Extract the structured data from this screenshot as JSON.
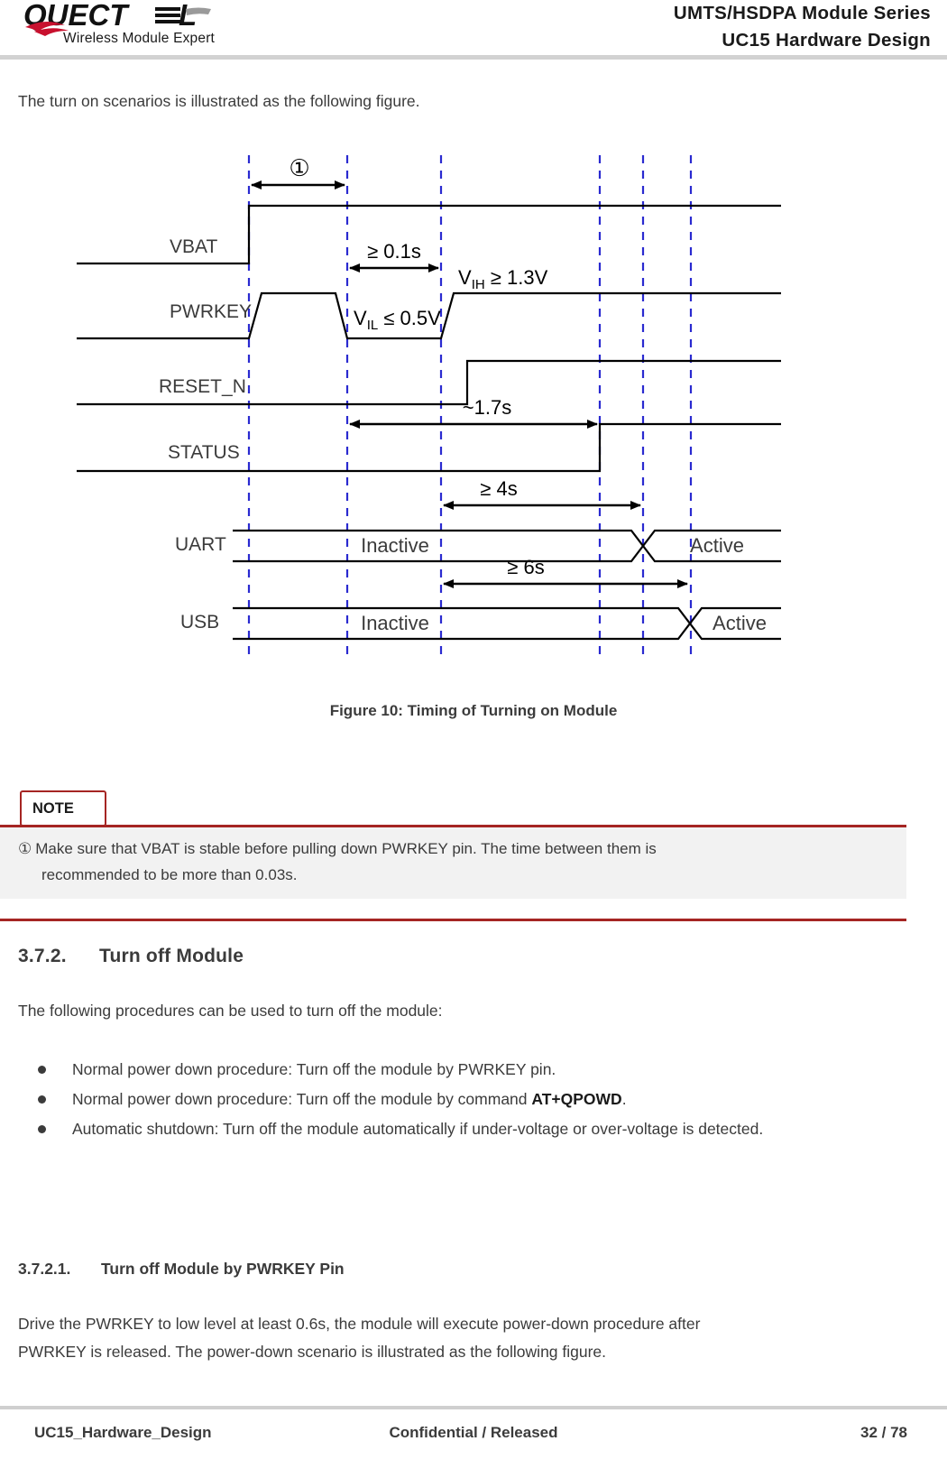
{
  "header": {
    "logo_text": "QUECTEL",
    "logo_tagline": "Wireless Module Expert",
    "title_line1": "UMTS/HSDPA  Module  Series",
    "title_line2": "UC15  Hardware  Design"
  },
  "intro_paragraph": "The turn on scenarios is illustrated as the following figure.",
  "figure": {
    "caption": "Figure 10: Timing of Turning on Module",
    "signals": [
      {
        "name": "VBAT"
      },
      {
        "name": "PWRKEY"
      },
      {
        "name": "RESET_N"
      },
      {
        "name": "STATUS"
      },
      {
        "name": "UART"
      },
      {
        "name": "USB"
      }
    ],
    "annotations": {
      "marker_one": "①",
      "pwrkey_low_time": "≥ 0.1s",
      "vih": "V",
      "vih_sub": "IH",
      "vih_val": " ≥ 1.3V",
      "vil": "V",
      "vil_sub": "IL",
      "vil_val": " ≤ 0.5V",
      "status_time": "~1.7s",
      "uart_time": "≥ 4s",
      "usb_time": "≥ 6s",
      "uart_state_before": "Inactive",
      "uart_state_after": "Active",
      "usb_state_before": "Inactive",
      "usb_state_after": "Active"
    },
    "colors": {
      "dashed_line": "#2a2ad0",
      "waveform": "#000000"
    }
  },
  "note": {
    "label": "NOTE",
    "marker": "①",
    "line1": "Make  sure  that  VBAT  is  stable  before  pulling  down  PWRKEY  pin.  The  time  between  them  is",
    "line2": "recommended to be more than 0.03s.",
    "accent_color": "#a52523"
  },
  "section_turn_off": {
    "number": "3.7.2.",
    "title": "Turn off Module",
    "paragraph": "The following procedures can be used to turn off the module:",
    "bullets": [
      {
        "text_before": "Normal power down procedure: Turn off the module by PWRKEY pin.",
        "bold": "",
        "text_after": ""
      },
      {
        "text_before": "Normal power down procedure: Turn off the module by command ",
        "bold": "AT+QPOWD",
        "text_after": "."
      },
      {
        "text_before": "Automatic shutdown: Turn off the module automatically if under-voltage or over-voltage is detected.",
        "bold": "",
        "text_after": ""
      }
    ]
  },
  "subsection_pwrkey": {
    "number": "3.7.2.1.",
    "title": "Turn off Module by PWRKEY Pin",
    "paragraph_line1": "Drive  the  PWRKEY  to  low  level  at  least  0.6s,  the  module  will  execute  power-down  procedure  after",
    "paragraph_line2": "PWRKEY is released. The power-down scenario is illustrated as the following figure."
  },
  "footer": {
    "document_name": "UC15_Hardware_Design",
    "classification": "Confidential / Released",
    "page": "32 / 78"
  }
}
